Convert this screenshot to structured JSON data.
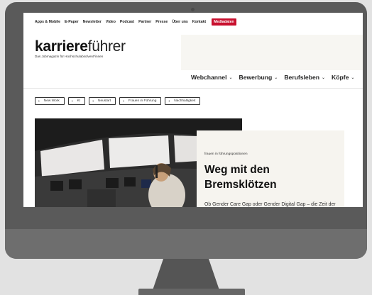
{
  "top_nav": [
    "Apps & Mobile",
    "E-Paper",
    "Newsletter",
    "Video",
    "Podcast",
    "Partner",
    "Presse",
    "Über uns",
    "Kontakt"
  ],
  "mediadaten_label": "Mediadaten",
  "logo": {
    "bold": "karriere",
    "light": "führer"
  },
  "tagline": "Das Jobmagazin für Hochschulabsolvent*innen",
  "main_nav": [
    "Webchannel",
    "Bewerbung",
    "Berufsleben",
    "Köpfe"
  ],
  "tags": [
    "New Work",
    "KI",
    "Neustart",
    "Frauen in Führung",
    "Nachhaltigkeit"
  ],
  "article": {
    "kicker": "frauen in führungspositionen",
    "headline": "Weg mit den Bremsklötzen",
    "teaser": "Ob Gender Care Gap oder Gender Digital Gap – die Zeit der Gräben zwischen den Geschlechtern"
  },
  "colors": {
    "accent": "#c8102e",
    "card_bg": "#f6f4ef",
    "monitor": "#5a5a5a"
  },
  "icons": {
    "tag_arrow": "chevron-right-icon",
    "nav_chevron": "chevron-down-icon"
  }
}
